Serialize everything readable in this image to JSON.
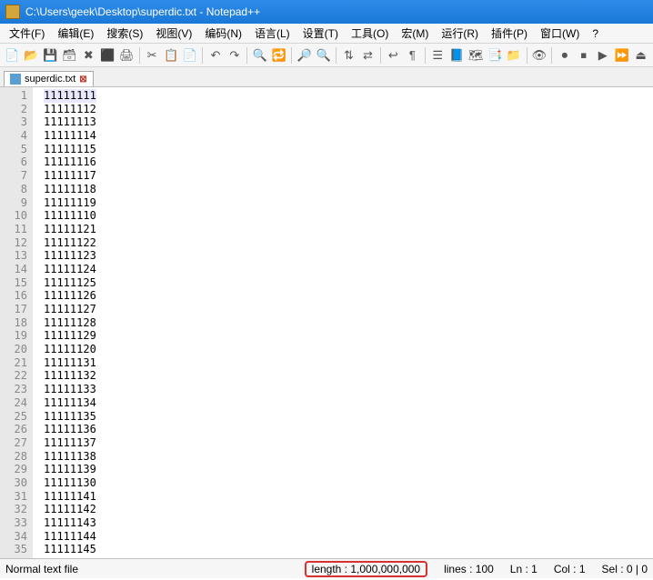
{
  "titlebar": {
    "icon_name": "app-icon",
    "title": "C:\\Users\\geek\\Desktop\\superdic.txt - Notepad++"
  },
  "menubar": {
    "items": [
      {
        "label": "文件(F)"
      },
      {
        "label": "编辑(E)"
      },
      {
        "label": "搜索(S)"
      },
      {
        "label": "视图(V)"
      },
      {
        "label": "编码(N)"
      },
      {
        "label": "语言(L)"
      },
      {
        "label": "设置(T)"
      },
      {
        "label": "工具(O)"
      },
      {
        "label": "宏(M)"
      },
      {
        "label": "运行(R)"
      },
      {
        "label": "插件(P)"
      },
      {
        "label": "窗口(W)"
      },
      {
        "label": "?"
      }
    ]
  },
  "toolbar": {
    "groups": [
      [
        "new-file-icon",
        "open-file-icon",
        "save-icon",
        "save-all-icon",
        "close-icon",
        "close-all-icon",
        "print-icon"
      ],
      [
        "cut-icon",
        "copy-icon",
        "paste-icon"
      ],
      [
        "undo-icon",
        "redo-icon"
      ],
      [
        "find-icon",
        "replace-icon"
      ],
      [
        "zoom-in-icon",
        "zoom-out-icon"
      ],
      [
        "sync-v-icon",
        "sync-h-icon"
      ],
      [
        "wrap-icon",
        "show-all-icon"
      ],
      [
        "indent-guide-icon",
        "lang-icon",
        "doc-map-icon",
        "func-list-icon",
        "folder-icon"
      ],
      [
        "monitor-icon"
      ],
      [
        "record-icon",
        "stop-icon",
        "play-icon",
        "play-multi-icon",
        "save-macro-icon"
      ]
    ],
    "glyphs": {
      "new-file-icon": "📄",
      "open-file-icon": "📂",
      "save-icon": "💾",
      "save-all-icon": "🗃",
      "close-icon": "✖",
      "close-all-icon": "⬛",
      "print-icon": "🖨",
      "cut-icon": "✂",
      "copy-icon": "📋",
      "paste-icon": "📄",
      "undo-icon": "↶",
      "redo-icon": "↷",
      "find-icon": "🔍",
      "replace-icon": "🔁",
      "zoom-in-icon": "🔎",
      "zoom-out-icon": "🔍",
      "sync-v-icon": "⇅",
      "sync-h-icon": "⇄",
      "wrap-icon": "↩",
      "show-all-icon": "¶",
      "indent-guide-icon": "☰",
      "lang-icon": "📘",
      "doc-map-icon": "🗺",
      "func-list-icon": "📑",
      "folder-icon": "📁",
      "monitor-icon": "👁",
      "record-icon": "⏺",
      "stop-icon": "⏹",
      "play-icon": "▶",
      "play-multi-icon": "⏩",
      "save-macro-icon": "⏏"
    }
  },
  "tab": {
    "label": "superdic.txt",
    "close_glyph": "⊠"
  },
  "editor": {
    "lines": [
      "11111111",
      "11111112",
      "11111113",
      "11111114",
      "11111115",
      "11111116",
      "11111117",
      "11111118",
      "11111119",
      "11111110",
      "11111121",
      "11111122",
      "11111123",
      "11111124",
      "11111125",
      "11111126",
      "11111127",
      "11111128",
      "11111129",
      "11111120",
      "11111131",
      "11111132",
      "11111133",
      "11111134",
      "11111135",
      "11111136",
      "11111137",
      "11111138",
      "11111139",
      "11111130",
      "11111141",
      "11111142",
      "11111143",
      "11111144",
      "11111145"
    ]
  },
  "statusbar": {
    "filetype": "Normal text file",
    "length": "length : 1,000,000,000",
    "lines": "lines : 100",
    "ln": "Ln : 1",
    "col": "Col : 1",
    "sel": "Sel : 0 | 0"
  }
}
